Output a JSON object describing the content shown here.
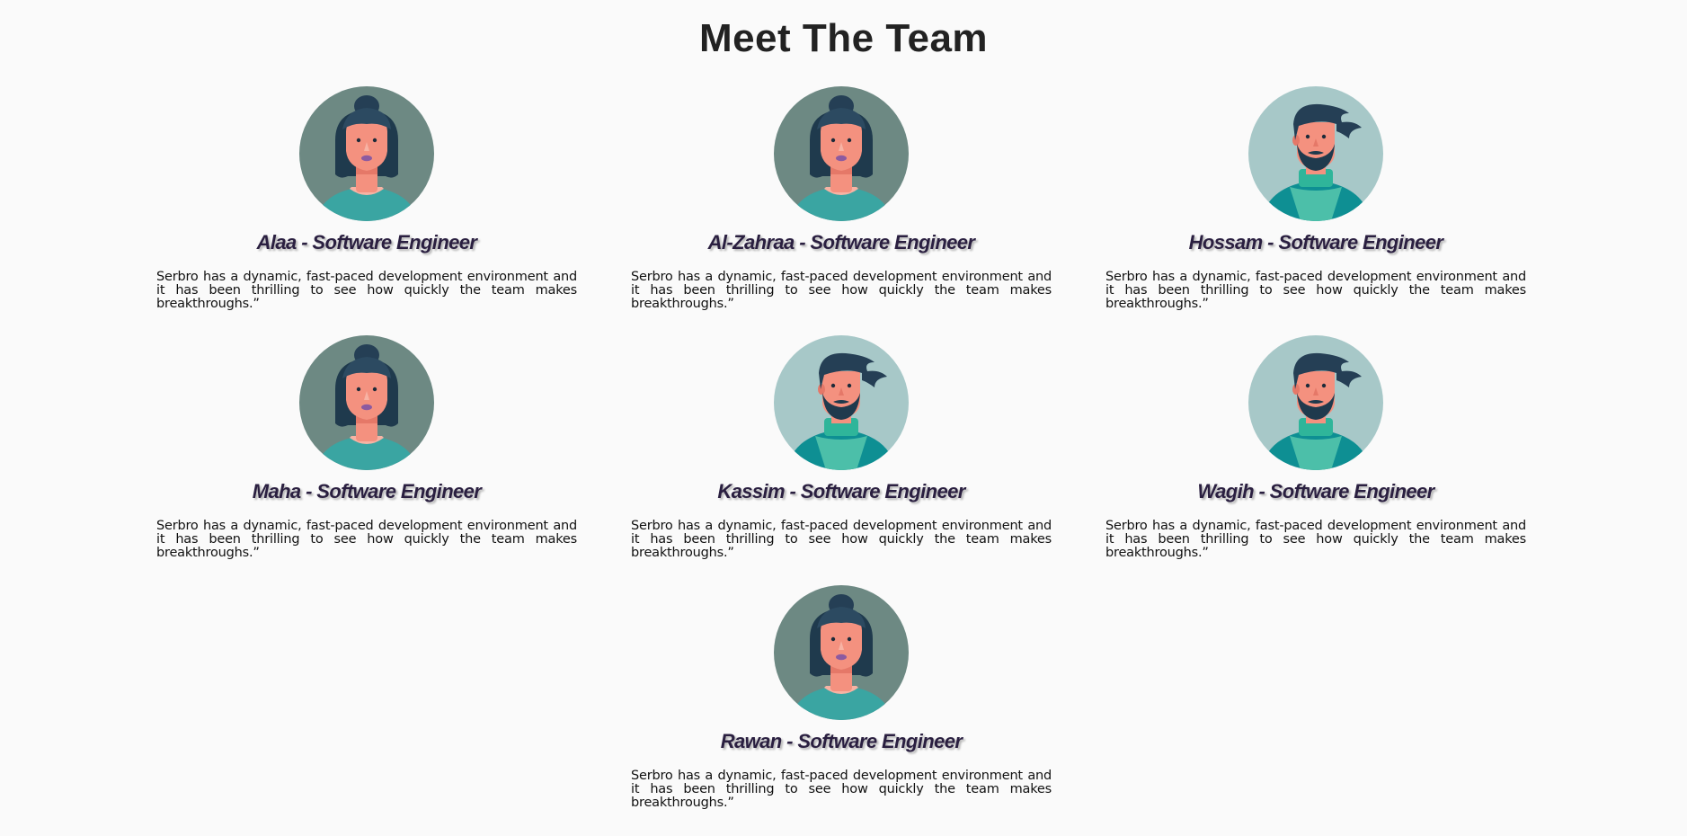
{
  "page": {
    "title": "Meet The Team"
  },
  "team": [
    {
      "name": "Alaa - Software Engineer",
      "bio": "Serbro has a dynamic, fast-paced development environment and it has been thrilling to see how quickly the team makes breakthroughs.”",
      "avatar": "female-avatar-icon"
    },
    {
      "name": "Al-Zahraa - Software Engineer",
      "bio": "Serbro has a dynamic, fast-paced development environment and it has been thrilling to see how quickly the team makes breakthroughs.”",
      "avatar": "female-avatar-icon"
    },
    {
      "name": "Hossam - Software Engineer",
      "bio": "Serbro has a dynamic, fast-paced development environment and it has been thrilling to see how quickly the team makes breakthroughs.”",
      "avatar": "male-avatar-icon"
    },
    {
      "name": "Maha - Software Engineer",
      "bio": "Serbro has a dynamic, fast-paced development environment and it has been thrilling to see how quickly the team makes breakthroughs.”",
      "avatar": "female-avatar-icon"
    },
    {
      "name": "Kassim - Software Engineer",
      "bio": "Serbro has a dynamic, fast-paced development environment and it has been thrilling to see how quickly the team makes breakthroughs.”",
      "avatar": "male-avatar-icon"
    },
    {
      "name": "Wagih - Software Engineer",
      "bio": "Serbro has a dynamic, fast-paced development environment and it has been thrilling to see how quickly the team makes breakthroughs.”",
      "avatar": "male-avatar-icon"
    },
    {
      "name": "Rawan - Software Engineer",
      "bio": "Serbro has a dynamic, fast-paced development environment and it has been thrilling to see how quickly the team makes breakthroughs.”",
      "avatar": "female-avatar-icon"
    }
  ],
  "colors": {
    "background": "#fafafa",
    "title": "#222222",
    "name": "#2a1f40",
    "female_bg": "#6d8983",
    "male_bg": "#a7c8c8"
  }
}
